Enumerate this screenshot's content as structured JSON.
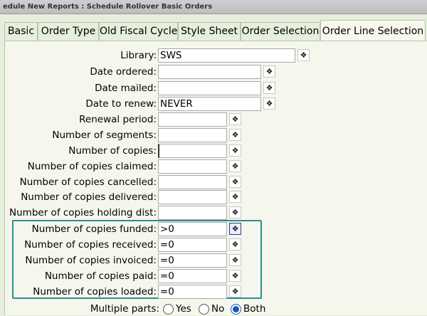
{
  "window": {
    "title": "edule New Reports : Schedule Rollover Basic Orders"
  },
  "tabs": [
    {
      "label": "Basic"
    },
    {
      "label": "Order Type"
    },
    {
      "label": "Old Fiscal Cycle"
    },
    {
      "label": "Style Sheet"
    },
    {
      "label": "Order Selection"
    },
    {
      "label": "Order Line Selection",
      "active": true
    }
  ],
  "fields": {
    "library": {
      "label": "Library:",
      "value": "SWS"
    },
    "date_ordered": {
      "label": "Date ordered:",
      "value": ""
    },
    "date_mailed": {
      "label": "Date mailed:",
      "value": ""
    },
    "date_to_renew": {
      "label": "Date to renew:",
      "value": "NEVER"
    },
    "renewal_period": {
      "label": "Renewal period:",
      "value": ""
    },
    "num_segments": {
      "label": "Number of segments:",
      "value": ""
    },
    "num_copies": {
      "label": "Number of copies:",
      "value": ""
    },
    "num_copies_claimed": {
      "label": "Number of copies claimed:",
      "value": ""
    },
    "num_copies_cancelled": {
      "label": "Number of copies cancelled:",
      "value": ""
    },
    "num_copies_delivered": {
      "label": "Number of copies delivered:",
      "value": ""
    },
    "num_copies_holding_dist": {
      "label": "Number of copies holding dist:",
      "value": ""
    },
    "num_copies_funded": {
      "label": "Number of copies funded:",
      "value": ">0"
    },
    "num_copies_received": {
      "label": "Number of copies received:",
      "value": "=0"
    },
    "num_copies_invoiced": {
      "label": "Number of copies invoiced:",
      "value": "=0"
    },
    "num_copies_paid": {
      "label": "Number of copies paid:",
      "value": "=0"
    },
    "num_copies_loaded": {
      "label": "Number of copies loaded:",
      "value": "=0"
    }
  },
  "multiple_parts": {
    "label": "Multiple parts:",
    "options": [
      "Yes",
      "No",
      "Both"
    ],
    "selected": "Both"
  },
  "icons": {
    "picker": "gear-icon"
  },
  "colors": {
    "highlight_box": "#2a8f8f",
    "radio_selected": "#1b55c0"
  }
}
